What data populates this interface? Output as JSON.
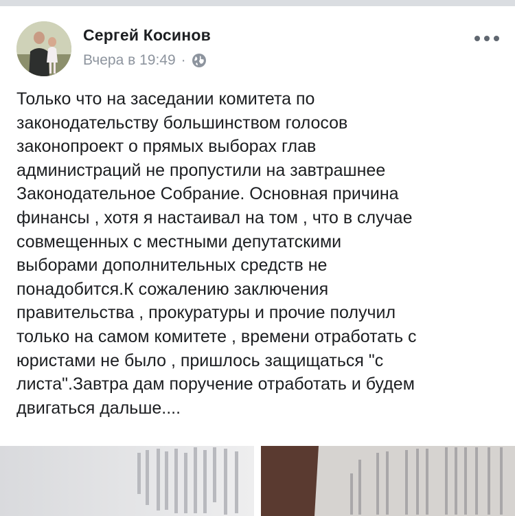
{
  "post": {
    "author": "Сергей Косинов",
    "time": "Вчера в 19:49",
    "separator": "·",
    "audience_icon": "globe-icon",
    "menu_icon": "more-options-icon",
    "text": "Только что на заседании комитета по\nзаконодательству большинством голосов\nзаконопроект о прямых выборах глав\nадминистраций не пропустили на завтрашнее\nЗаконодательное Собрание. Основная причина\nфинансы , хотя я настаивал на том , что в случае\nсовмещенных с местными депутатскими\nвыборами дополнительных средств не\nпонадобится.К сожалению заключения\nправительства , прокуратуры и прочие получил\nтолько на самом комитете , времени отработать с\nюристами не было , пришлось защищаться \"с\nлиста\".Завтра дам поручение отработать и будем\nдвигаться дальше...."
  },
  "colors": {
    "text": "#1c1e21",
    "secondary_text": "#8d949e",
    "divider": "#dadde1"
  }
}
